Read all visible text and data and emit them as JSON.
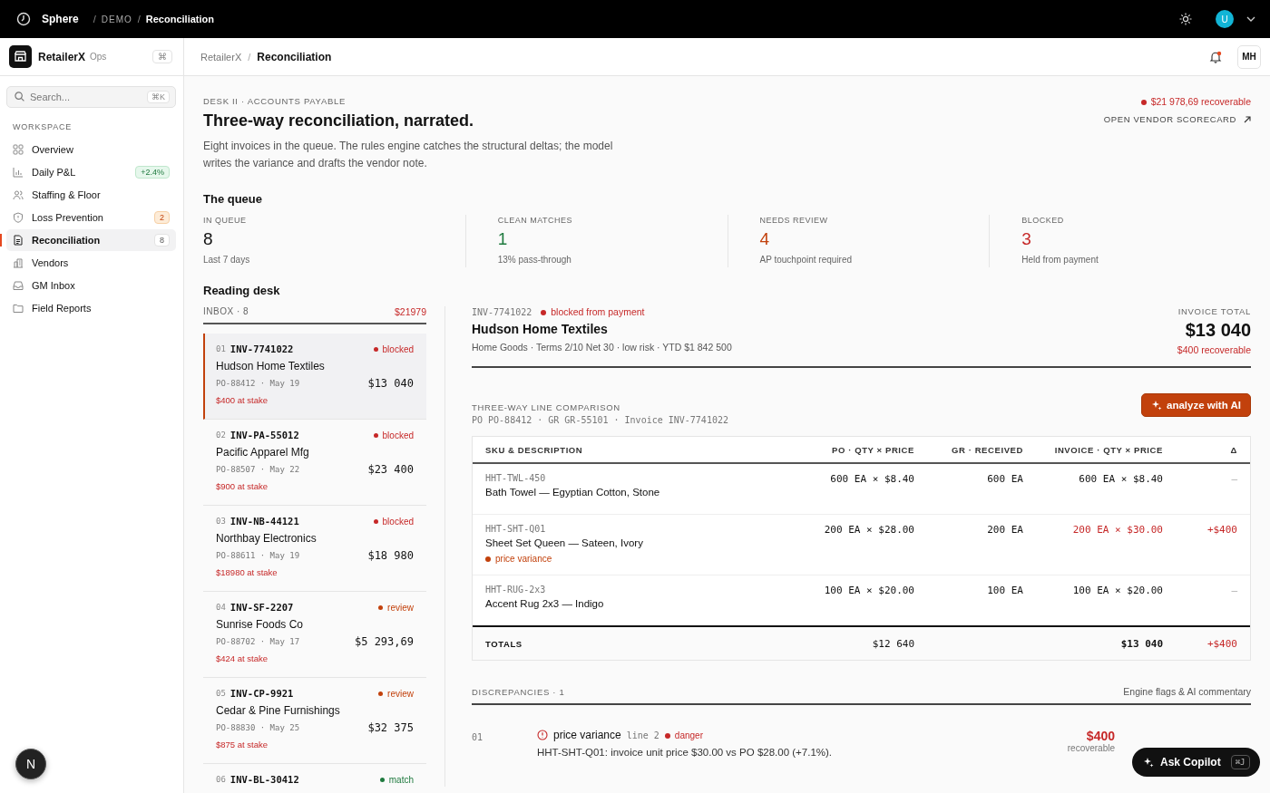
{
  "topbar": {
    "brand": "Sphere",
    "separator": "/",
    "crumbs": [
      "DEMO",
      "Reconciliation"
    ],
    "avatar": "U"
  },
  "sidebar": {
    "brand": "RetailerX",
    "brand_sub": "Ops",
    "shortcut": "⌘",
    "search": {
      "placeholder": "Search...",
      "shortcut": "⌘K"
    },
    "section": "WORKSPACE",
    "items": [
      {
        "label": "Overview",
        "selected": false
      },
      {
        "label": "Daily P&L",
        "selected": false,
        "badge": "+2.4%",
        "kind": "positive"
      },
      {
        "label": "Staffing & Floor",
        "selected": false
      },
      {
        "label": "Loss Prevention",
        "selected": false,
        "badge": "2",
        "kind": "warning"
      },
      {
        "label": "Reconciliation",
        "selected": true,
        "badge": "8",
        "kind": "neutral"
      },
      {
        "label": "Vendors",
        "selected": false
      },
      {
        "label": "GM Inbox",
        "selected": false
      },
      {
        "label": "Field Reports",
        "selected": false
      }
    ]
  },
  "header": {
    "crumbs": [
      "RetailerX",
      "Reconciliation"
    ],
    "separator": "/",
    "notification": true,
    "user": "MH"
  },
  "intro": {
    "eyebrow": "DESK II · ACCOUNTS PAYABLE",
    "title": "Three-way reconciliation, narrated.",
    "text": "Eight invoices in the queue. The rules engine catches the structural deltas; the model writes the variance and drafts the vendor note.",
    "recoverable": "$21 978,69 recoverable",
    "link": "OPEN VENDOR SCORECARD"
  },
  "queue": {
    "title": "The queue",
    "stats": [
      {
        "label": "IN QUEUE",
        "value": "8",
        "note": "Last 7 days",
        "color": "#111111"
      },
      {
        "label": "CLEAN MATCHES",
        "value": "1",
        "note": "13% pass-through",
        "color": "#1f7a3f"
      },
      {
        "label": "NEEDS REVIEW",
        "value": "4",
        "note": "AP touchpoint required",
        "color": "#c2410c"
      },
      {
        "label": "BLOCKED",
        "value": "3",
        "note": "Held from payment",
        "color": "#c62828"
      }
    ]
  },
  "desk": {
    "title": "Reading desk",
    "inbox_label": "INBOX · 8",
    "inbox_total": "$21979",
    "items": [
      {
        "num": "01",
        "id": "INV-7741022",
        "status": "blocked",
        "color": "#c62828",
        "vendor": "Hudson Home Textiles",
        "meta": "PO-88412 · May 19",
        "amount": "$13 040",
        "stake": "$400 at stake",
        "selected": true
      },
      {
        "num": "02",
        "id": "INV-PA-55012",
        "status": "blocked",
        "color": "#c62828",
        "vendor": "Pacific Apparel Mfg",
        "meta": "PO-88507 · May 22",
        "amount": "$23 400",
        "stake": "$900 at stake",
        "selected": false
      },
      {
        "num": "03",
        "id": "INV-NB-44121",
        "status": "blocked",
        "color": "#c62828",
        "vendor": "Northbay Electronics",
        "meta": "PO-88611 · May 19",
        "amount": "$18 980",
        "stake": "$18980 at stake",
        "selected": false
      },
      {
        "num": "04",
        "id": "INV-SF-2207",
        "status": "review",
        "color": "#c2410c",
        "vendor": "Sunrise Foods Co",
        "meta": "PO-88702 · May 17",
        "amount": "$5 293,69",
        "stake": "$424 at stake",
        "selected": false
      },
      {
        "num": "05",
        "id": "INV-CP-9921",
        "status": "review",
        "color": "#c2410c",
        "vendor": "Cedar & Pine Furnishings",
        "meta": "PO-88830 · May 25",
        "amount": "$32 375",
        "stake": "$875 at stake",
        "selected": false
      },
      {
        "num": "06",
        "id": "INV-BL-30412",
        "status": "match",
        "color": "#1f7a3f",
        "selected": false
      }
    ]
  },
  "detail": {
    "id": "INV-7741022",
    "status": "blocked from payment",
    "vendor": "Hudson Home Textiles",
    "meta": "Home Goods · Terms 2/10 Net 30 · low risk · YTD $1 842 500",
    "total_label": "INVOICE TOTAL",
    "total": "$13 040",
    "recoverable": "$400 recoverable",
    "comparison_title": "THREE-WAY LINE COMPARISON",
    "comparison_refs": "PO PO-88412 · GR GR-55101 · Invoice INV-7741022",
    "analyze_button": "analyze with AI",
    "table": {
      "columns": [
        "SKU & DESCRIPTION",
        "PO · QTY × PRICE",
        "GR · RECEIVED",
        "INVOICE · QTY × PRICE",
        "Δ"
      ],
      "rows": [
        {
          "sku": "HHT-TWL-450",
          "description": "Bath Towel — Egyptian Cotton, Stone",
          "po": "600 EA × $8.40",
          "gr": "600 EA",
          "invoice": "600 EA × $8.40",
          "delta": "—",
          "variance": false
        },
        {
          "sku": "HHT-SHT-Q01",
          "description": "Sheet Set Queen — Sateen, Ivory",
          "flag": "price variance",
          "po": "200 EA × $28.00",
          "gr": "200 EA",
          "invoice": "200 EA × $30.00",
          "delta": "+$400",
          "variance": true
        },
        {
          "sku": "HHT-RUG-2x3",
          "description": "Accent Rug 2x3 — Indigo",
          "po": "100 EA × $20.00",
          "gr": "100 EA",
          "invoice": "100 EA × $20.00",
          "delta": "—",
          "variance": false
        }
      ],
      "totals": {
        "label": "TOTALS",
        "po": "$12 640",
        "invoice": "$13 040",
        "delta": "+$400"
      }
    },
    "discrepancies": {
      "title": "DISCREPANCIES · 1",
      "note": "Engine flags & AI commentary",
      "items": [
        {
          "num": "01",
          "title": "price variance",
          "line": "line 2",
          "severity": "danger",
          "text": "HHT-SHT-Q01: invoice unit price $30.00 vs PO $28.00 (+7.1%).",
          "amount": "$400",
          "amount_note": "recoverable"
        }
      ]
    }
  },
  "fab": {
    "letter": "N"
  },
  "copilot": {
    "label": "Ask Copilot",
    "shortcut": "⌘J"
  }
}
